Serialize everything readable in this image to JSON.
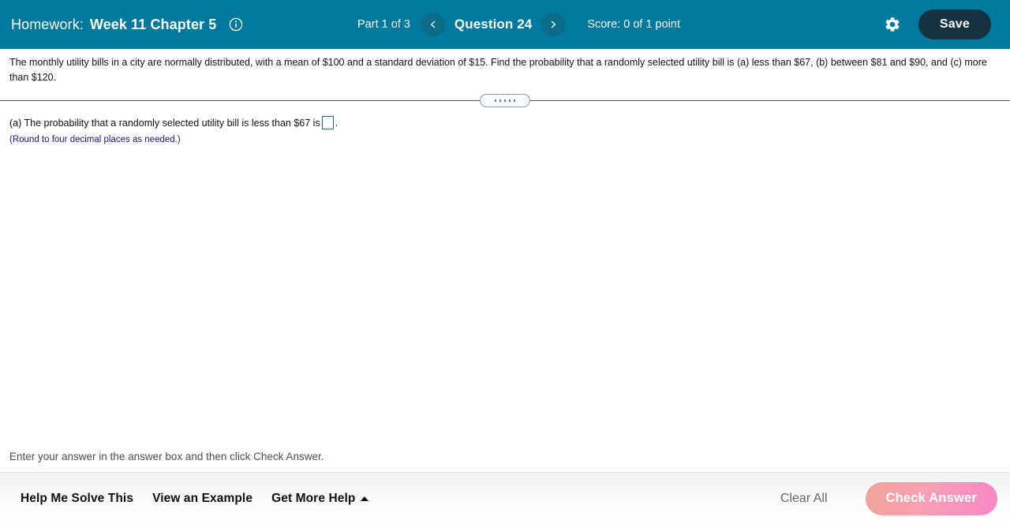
{
  "header": {
    "homework_label": "Homework:",
    "homework_title": "Week 11 Chapter 5",
    "info_icon": "info-circle-icon",
    "part_label": "Part 1 of 3",
    "prev_icon": "chevron-left-icon",
    "next_icon": "chevron-right-icon",
    "question_label": "Question 24",
    "score_label": "Score: 0 of 1 point",
    "settings_icon": "gear-icon",
    "save_label": "Save",
    "colors": {
      "background": "#00799e",
      "nav_button": "#0c6b88",
      "save_button": "#16313f"
    }
  },
  "problem": {
    "text": "The monthly utility bills in a city are normally distributed, with a mean of $100 and a standard deviation of $15. Find the probability that a randomly selected utility bill is (a) less than $67, (b) between $81 and $90, and (c) more than $120."
  },
  "splitter": {
    "handle_icon": "drag-handle-dots-icon",
    "dot_count": 5
  },
  "answer": {
    "prompt_before": "(a) The probability that a randomly selected utility bill is less than $67 is",
    "prompt_after": ".",
    "input_value": "",
    "input_placeholder": "",
    "round_note": "(Round to four decimal places as needed.)",
    "input_border_color": "#1673a0",
    "note_color": "#23108f"
  },
  "status": {
    "text": "Enter your answer in the answer box and then click Check Answer."
  },
  "footer": {
    "help_me_solve_this": "Help Me Solve This",
    "view_an_example": "View an Example",
    "get_more_help": "Get More Help",
    "get_more_help_icon": "caret-up-icon",
    "clear_all": "Clear All",
    "check_answer": "Check Answer",
    "check_answer_gradient_start": "#f4a39c",
    "check_answer_gradient_end": "#f787c4"
  }
}
